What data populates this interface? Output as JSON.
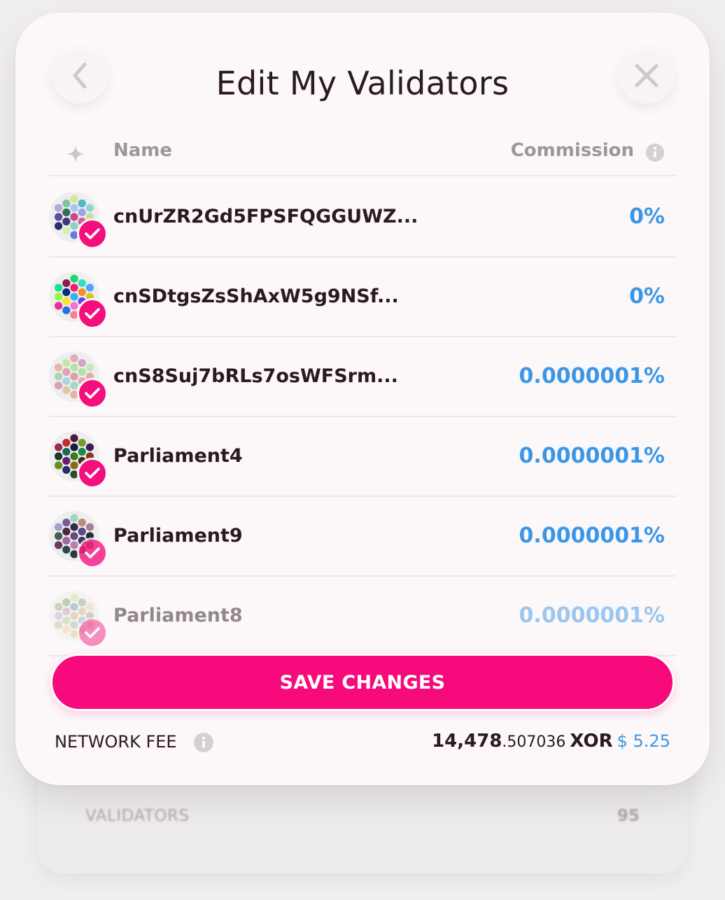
{
  "dialog": {
    "title": "Edit My Validators",
    "back_icon": "chevron-left-icon",
    "close_icon": "close-icon"
  },
  "table": {
    "name_header": "Name",
    "commission_header": "Commission",
    "rows": [
      {
        "name": "cnUrZR2Gd5FPSFQGGUWZ...",
        "commission": "0%",
        "selected": true,
        "colors": [
          "#d4e79e",
          "#a3c9f0",
          "#c84a8a",
          "#8cd3c2",
          "#6b78d6",
          "#7cc4a1",
          "#2f6e5e",
          "#3e3a7e",
          "#d8f0b5",
          "#54b6c7",
          "#9aa7e6",
          "#d15c9c",
          "#3a8a6b",
          "#b6a7e0",
          "#5f4aa0",
          "#2d2d6b",
          "#92d4d0",
          "#c3e0a1",
          "#7a2f6b"
        ]
      },
      {
        "name": "cnSDtgsZsShAxW5g9NSf...",
        "commission": "0%",
        "selected": true,
        "colors": [
          "#19d86a",
          "#f21b75",
          "#2fb4f0",
          "#f76fd8",
          "#ff7a8a",
          "#8a1f4f",
          "#0a2f7a",
          "#f5e52b",
          "#2a6ee8",
          "#35e0c9",
          "#f58f2c",
          "#6a3ee0",
          "#ff4c4c",
          "#1be08f",
          "#9af542",
          "#e42f9f",
          "#4fa3ff",
          "#e0c21f",
          "#12c9a9"
        ]
      },
      {
        "name": "cnS8Suj7bRLs7osWFSrm...",
        "commission": "0.0000001%",
        "selected": true,
        "colors": [
          "#e6a7b8",
          "#b6e2a4",
          "#d9a0a8",
          "#a3d9c8",
          "#e9b0a0",
          "#c6e6a8",
          "#e0a2b6",
          "#a8d8e0",
          "#e7c4a0",
          "#d4a4c0",
          "#b0e0b0",
          "#e8a8a8",
          "#c0d0e8",
          "#e2b8a4",
          "#a6d6b4",
          "#dca0b2",
          "#c8e4c0",
          "#e4aaa0",
          "#b8dcd4"
        ]
      },
      {
        "name": "Parliament4",
        "commission": "0.0000001%",
        "selected": true,
        "colors": [
          "#4a1a3a",
          "#1a1a4a",
          "#3a7a1a",
          "#8a6a1a",
          "#2a4a2a",
          "#c03020",
          "#1a6a5a",
          "#6a1a6a",
          "#2a2a6a",
          "#7a9a2a",
          "#1a8a4a",
          "#4a2a1a",
          "#2a6ad0",
          "#9a2a5a",
          "#1a3a2a",
          "#6a8a1a",
          "#3a1a5a",
          "#8a3a1a",
          "#1a5a8a"
        ]
      },
      {
        "name": "Parliament9",
        "commission": "0.0000001%",
        "selected": true,
        "colors": [
          "#a0d8b8",
          "#3a2a4a",
          "#6a4a7a",
          "#c07ab0",
          "#2a3a3a",
          "#7a5a9a",
          "#4a2a3a",
          "#9a6aa0",
          "#2a4a4a",
          "#c08a7a",
          "#5a4a8a",
          "#3a3a5a",
          "#8a6a4a",
          "#a0a0d0",
          "#4a5a5a",
          "#6a3a5a",
          "#b07a9a",
          "#2a2a3a",
          "#7a8a6a"
        ]
      },
      {
        "name": "Parliament8",
        "commission": "0.0000001%",
        "selected": true,
        "colors": [
          "#c8e0a0",
          "#7a9aa8",
          "#e0b070",
          "#a0c0a0",
          "#e8c890",
          "#8aa070",
          "#c0a0b0",
          "#b0d0a0",
          "#f0d0a0",
          "#90a8a0",
          "#d0b890",
          "#a0b0c0",
          "#e0c0a0",
          "#9ab080",
          "#c8b0c0",
          "#b8c8a0",
          "#e8d0b0",
          "#a8a890",
          "#d0c0a0"
        ]
      }
    ]
  },
  "actions": {
    "save_label": "SAVE CHANGES"
  },
  "fee": {
    "label": "NETWORK FEE",
    "amount_int": "14,478",
    "amount_dec": ".507036",
    "symbol": "XOR",
    "usd": "$ 5.25"
  },
  "background": {
    "label": "VALIDATORS",
    "value": "95"
  }
}
